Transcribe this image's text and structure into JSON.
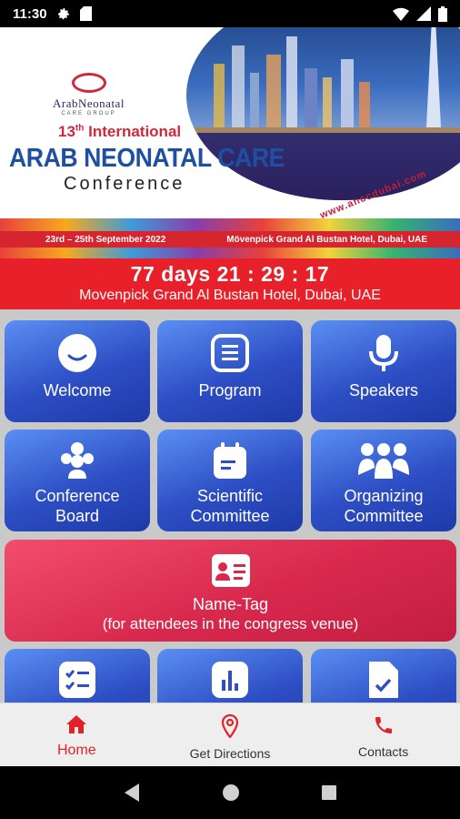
{
  "status_bar": {
    "time": "11:30",
    "icons": [
      "settings-icon",
      "sd-card-icon",
      "wifi-icon",
      "signal-icon",
      "battery-icon"
    ]
  },
  "banner": {
    "logo_title": "ArabNeonatal",
    "logo_subtitle": "CARE GROUP",
    "edition": "13",
    "edition_suffix": "th",
    "edition_label": "International",
    "title": "ARAB NEONATAL CARE",
    "subtitle": "Conference",
    "url": "www.anccdubai.com",
    "dates": "23rd – 25th September 2022",
    "venue_short": "Mövenpick Grand Al Bustan Hotel, Dubai, UAE"
  },
  "countdown": {
    "text": "77 days 21 : 29 : 17",
    "venue": "Movenpick Grand Al Bustan Hotel, Dubai, UAE"
  },
  "tiles": {
    "welcome": "Welcome",
    "program": "Program",
    "speakers": "Speakers",
    "board_1": "Conference",
    "board_2": "Board",
    "scientific_1": "Scientific",
    "scientific_2": "Committee",
    "organizing_1": "Organizing",
    "organizing_2": "Committee",
    "nametag": "Name-Tag",
    "nametag_sub": "(for attendees in the congress venue)"
  },
  "bottom_nav": {
    "home": "Home",
    "directions": "Get Directions",
    "contacts": "Contacts"
  },
  "colors": {
    "accent_red": "#e2222a",
    "tile_blue": "#2d4ec4",
    "tile_red": "#d8294d"
  }
}
